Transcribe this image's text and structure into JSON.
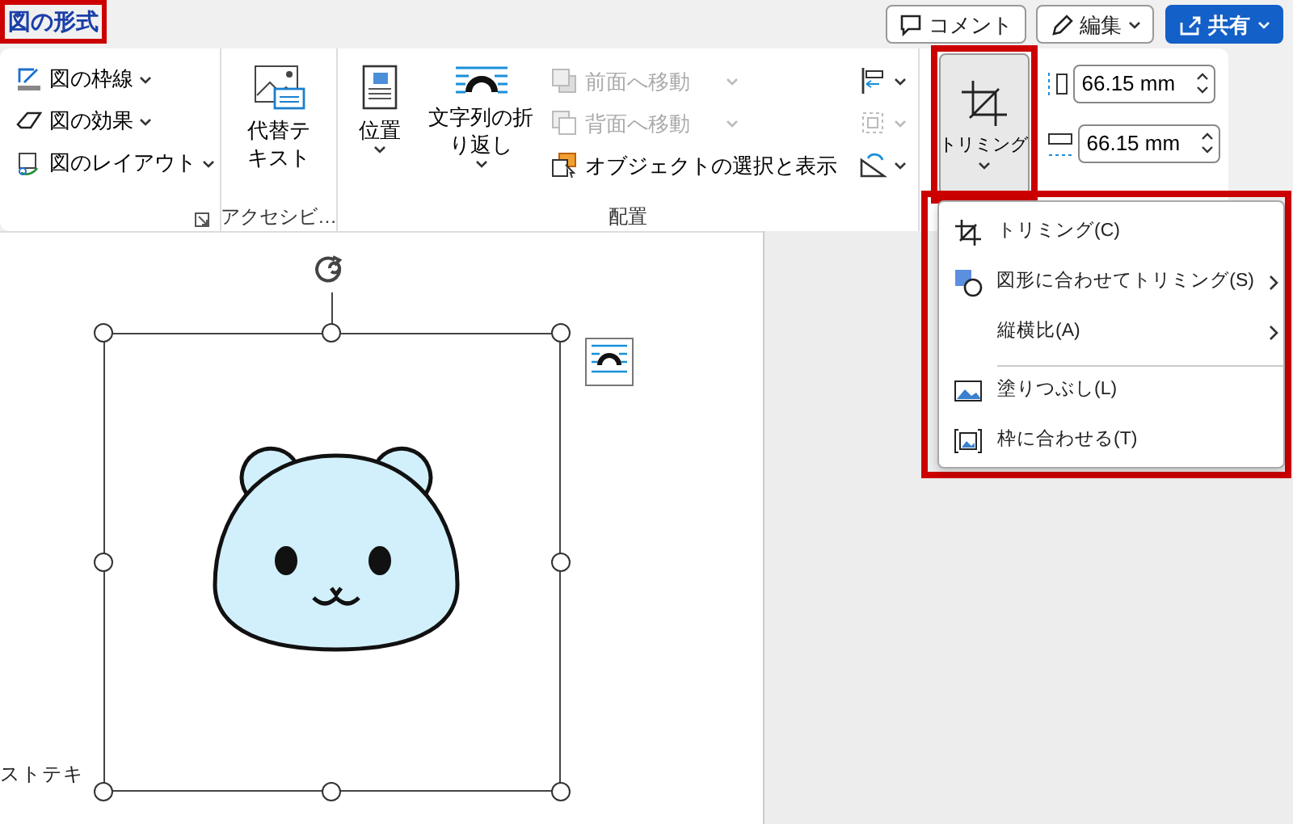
{
  "tab": {
    "label": "図の形式",
    "selected": true,
    "highlighted": true
  },
  "header_buttons": [
    {
      "kind": "comment",
      "label": "コメント",
      "has_menu": false
    },
    {
      "kind": "edit",
      "label": "編集",
      "has_menu": true
    },
    {
      "kind": "share",
      "label": "共有",
      "has_menu": true
    }
  ],
  "picture_styles": {
    "items": [
      {
        "kind": "border",
        "label": "図の枠線"
      },
      {
        "kind": "effects",
        "label": "図の効果"
      },
      {
        "kind": "layout",
        "label": "図のレイアウト"
      }
    ]
  },
  "accessibility": {
    "button": "代替テキスト",
    "group_label": "アクセシビ…"
  },
  "arrange": {
    "position": "位置",
    "wrap_text": "文字列の折り返し",
    "order_items": [
      {
        "kind": "forward",
        "label": "前面へ移動",
        "disabled": true,
        "has_menu": true
      },
      {
        "kind": "backward",
        "label": "背面へ移動",
        "disabled": true,
        "has_menu": true
      },
      {
        "kind": "pane",
        "label": "オブジェクトの選択と表示",
        "disabled": false,
        "has_menu": false
      }
    ],
    "tool_icons": [
      {
        "kind": "align",
        "disabled": false
      },
      {
        "kind": "group",
        "disabled": true
      },
      {
        "kind": "rotate",
        "disabled": false
      }
    ],
    "group_label": "配置"
  },
  "crop_button": {
    "label": "トリミング",
    "pressed": true,
    "highlighted": true
  },
  "size_fields": [
    {
      "kind": "height",
      "value": "66.15 mm"
    },
    {
      "kind": "width",
      "value": "66.15 mm"
    }
  ],
  "crop_menu": {
    "highlighted": true,
    "items": [
      {
        "kind": "crop",
        "label": "トリミング(C)",
        "submenu": false,
        "separator_before": false
      },
      {
        "kind": "shape",
        "label": "図形に合わせてトリミング(S)",
        "submenu": true,
        "separator_before": false
      },
      {
        "kind": "none",
        "label": "縦横比(A)",
        "submenu": true,
        "separator_before": false
      },
      {
        "kind": "fill",
        "label": "塗りつぶし(L)",
        "submenu": false,
        "separator_before": true
      },
      {
        "kind": "fit",
        "label": "枠に合わせる(T)",
        "submenu": false,
        "separator_before": false
      }
    ]
  },
  "document": {
    "text": "ストテキ",
    "picture_selected": true
  }
}
